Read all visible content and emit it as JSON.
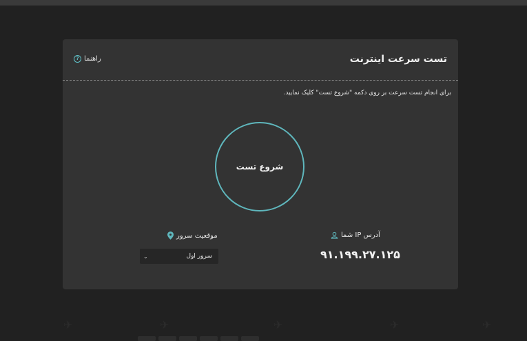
{
  "page": {
    "title": "تست سرعت اینترنت",
    "help_label": "راهنما",
    "instructions": "برای انجام تست سرعت بر روی دکمه \"شروع تست\" کلیک نمایید.",
    "start_button_label": "شروع تست",
    "ip_label": "آدرس IP شما",
    "ip_value": "۹۱.۱۹۹.۲۷.۱۲۵",
    "server_label": "موقعیت سرور",
    "server_selected": "سرور اول"
  },
  "colors": {
    "accent": "#5fb7bd",
    "background": "#212121",
    "card": "#333333"
  },
  "icons": {
    "help": "question-circle-icon",
    "user": "user-icon",
    "location": "map-pin-icon",
    "dropdown": "chevron-down-icon"
  }
}
